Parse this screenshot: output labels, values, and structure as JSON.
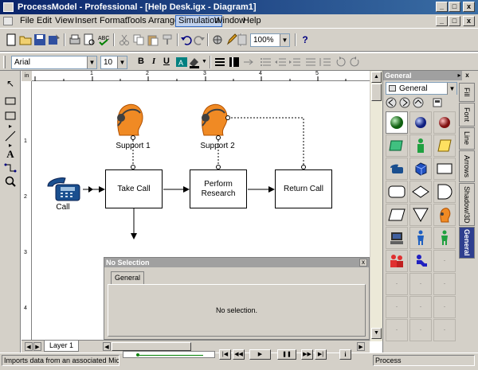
{
  "window": {
    "title": "ProcessModel - Professional - [Help Desk.igx - Diagram1]",
    "min_glyph": "_",
    "max_glyph": "□",
    "close_glyph": "x"
  },
  "menu": {
    "items": [
      "File",
      "Edit",
      "View",
      "Insert",
      "Format",
      "Tools",
      "Arrange",
      "Simulation",
      "Window",
      "Help"
    ],
    "active": "Simulation"
  },
  "toolbar": {
    "zoom": "100%",
    "font": "Arial",
    "font_size": "10",
    "bold": "B",
    "italic": "I",
    "underline": "U",
    "help": "?"
  },
  "ruler": {
    "corner": "in",
    "top_ticks": [
      "1",
      "2",
      "3",
      "4",
      "5"
    ],
    "left_ticks": [
      "1",
      "2",
      "3",
      "4"
    ]
  },
  "diagram": {
    "resources": [
      {
        "label": "Support 1"
      },
      {
        "label": "Support 2"
      }
    ],
    "entry": {
      "label": "Call"
    },
    "activities": [
      {
        "label": "Take Call"
      },
      {
        "label": "Perform Research"
      },
      {
        "label": "Return Call"
      }
    ]
  },
  "properties": {
    "title": "No Selection",
    "tab": "General",
    "message": "No selection.",
    "close_glyph": "x"
  },
  "shapes_panel": {
    "title": "General",
    "category": "General",
    "vertical_tabs": [
      "Fill",
      "Font",
      "Line",
      "Arrows",
      "Shadow/3D",
      "General"
    ],
    "active_tab": "General"
  },
  "layer_tab": "Layer 1",
  "status": {
    "left": "Imports data from an associated Microso",
    "right": "Process"
  },
  "colors": {
    "title_start": "#0a246a",
    "title_end": "#3a6ea5",
    "resource_orange": "#f08a24",
    "phone_blue": "#1a4f8f",
    "panel_tab_active": "#2f3f8f"
  }
}
